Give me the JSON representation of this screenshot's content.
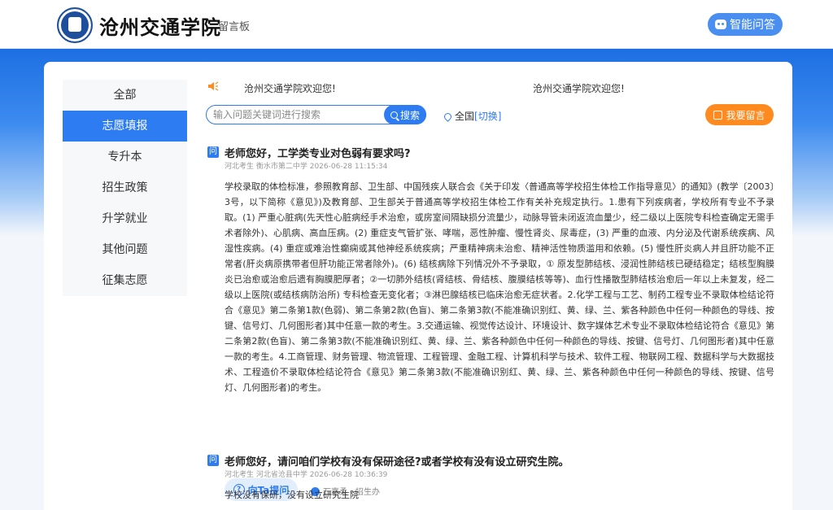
{
  "header": {
    "school_name": "沧州交通学院",
    "subtitle": "留言板",
    "ai_button": "智能问答"
  },
  "sidebar": {
    "items": [
      {
        "label": "全部"
      },
      {
        "label": "志愿填报"
      },
      {
        "label": "专升本"
      },
      {
        "label": "招生政策"
      },
      {
        "label": "升学就业"
      },
      {
        "label": "其他问题"
      },
      {
        "label": "征集志愿"
      }
    ],
    "active_index": 1
  },
  "notice": {
    "text_1": "沧州交通学院欢迎您!",
    "text_2": "沧州交通学院欢迎您!"
  },
  "search": {
    "placeholder": "输入问题关键词进行搜索",
    "button": "搜索"
  },
  "region": {
    "label": "全国",
    "switch": "[切换]"
  },
  "ask_button": "我要留言",
  "questions": [
    {
      "badge": "问",
      "title": "老师您好，工学类专业对色弱有要求吗?",
      "meta": "河北考生 衡水市第二中学 2026-06-28 11:15:34",
      "answer": "学校录取的体检标准，参照教育部、卫生部、中国残疾人联合会《关于印发〈普通高等学校招生体检工作指导意见〉的通知》(教学〔2003〕3号，以下简称《意见》)及教育部、卫生部关于普通高等学校招生体检工作有关补充规定执行。1.患有下列疾病者，学校所有专业不予录取。(1) 严重心脏病(先天性心脏病经手术治愈，或房室间隔缺损分流量少，动脉导管未闭返流血量少，经二级以上医院专科检查确定无需手术者除外)、心肌病、高血压病。(2) 重症支气管扩张、哮喘，恶性肿瘤、慢性肾炎、尿毒症，(3) 严重的血液、内分泌及代谢系统疾病、风湿性疾病。(4) 重症或难治性癫痫或其他神经系统疾病；严重精神病未治愈、精神活性物质滥用和依赖。(5) 慢性肝炎病人并且肝功能不正常者(肝炎病原携带者但肝功能正常者除外)。(6) 结核病除下列情况外不予录取，① 原发型肺结核、浸润性肺结核已硬结稳定；结核型胸膜炎已治愈或治愈后遗有胸膜肥厚者；②一切肺外结核(肾结核、骨结核、腹膜结核等等)、血行性播散型肺结核治愈后一年以上未复发，经二级以上医院(或结核病防治所) 专科检查无变化者；③淋巴腺结核已临床治愈无症状者。2.化学工程与工艺、制药工程专业不录取体检结论符合《意见》第二条第1款(色弱)、第二条第2款(色盲)、第二条第3款(不能准确识别红、黄、绿、兰、紫各种颜色中任何一种颜色的导线、按键、信号灯、几何图形者)其中任意一款的考生。3.交通运输、视觉传达设计、环境设计、数字媒体艺术专业不录取体检结论符合《意见》第二条第2款(色盲)、第二条第3款(不能准确识别红、黄、绿、兰、紫各种颜色中任何一种颜色的导线、按键、信号灯、几何图形者)其中任意一款的考生。4.工商管理、财务管理、物流管理、工程管理、金融工程、计算机科学与技术、软件工程、物联网工程、数据科学与大数据技术、工程造价不录取体检结论符合《意见》第二条第3款(不能准确识别红、黄、绿、兰、紫各种颜色中任何一种颜色的导线、按键、信号灯、几何图形者)的考生。",
      "ask_ta": "向Ta提问",
      "responder": "石嘉柔 - 招生办"
    },
    {
      "badge": "问",
      "title": "老师您好，请问咱们学校有没有保研途径?或者学校有没有设立研究生院。",
      "meta": "河北考生 河北省沧县中学 2026-06-28 10:36:39",
      "answer": "学校没有保研，没有设立研究生院"
    }
  ],
  "colors": {
    "primary": "#2d7cf2",
    "accent": "#ff8a1f",
    "banner": "#1d6fe2"
  }
}
